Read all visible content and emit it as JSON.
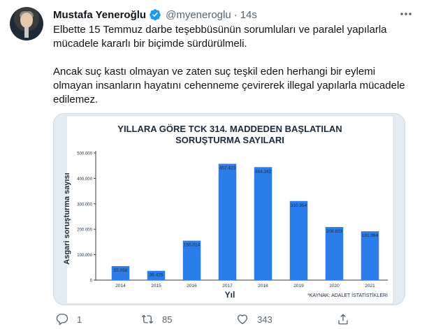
{
  "tweet": {
    "author_name": "Mustafa Yeneroğlu",
    "handle": "@myeneroglu",
    "separator": "·",
    "time": "14s",
    "paragraphs": [
      "Elbette 15 Temmuz darbe teşebbüsünün sorumluları ve paralel yapılarla mücadele kararlı bir biçimde sürdürülmeli.",
      "Ancak suç kastı olmayan ve zaten suç teşkil eden herhangi bir eylemi olmayan insanların hayatını cehenneme çevirerek illegal yapılarla mücadele edilemez."
    ],
    "stats": {
      "replies": "1",
      "retweets": "85",
      "likes": "343"
    },
    "icons": {
      "verified": "verified-badge-icon",
      "more": "more-icon",
      "reply": "reply-icon",
      "retweet": "retweet-icon",
      "like": "like-icon",
      "share": "share-icon"
    },
    "colors": {
      "verified": "#1d9bf0",
      "bar": "#2b7de9",
      "muted": "#536471"
    }
  },
  "chart_data": {
    "type": "bar",
    "title": "YILLARA GÖRE TCK 314. MADDEDEN BAŞLATILAN SORUŞTURMA SAYILARI",
    "title_lines": [
      "YILLARA GÖRE TCK 314. MADDEDEN BAŞLATILAN",
      "SORUŞTURMA SAYILARI"
    ],
    "xlabel": "Yıl",
    "ylabel": "Asgari soruşturma sayısı",
    "categories": [
      "2014",
      "2015",
      "2016",
      "2017",
      "2018",
      "2019",
      "2020",
      "2021"
    ],
    "values": [
      55058,
      36425,
      155014,
      457423,
      444342,
      310954,
      208833,
      191964
    ],
    "value_labels": [
      "55.058",
      "36.425",
      "155.014",
      "457.423",
      "444.342",
      "310.954",
      "208.833",
      "191.964"
    ],
    "y_ticks": [
      0,
      100000,
      200000,
      300000,
      400000,
      500000
    ],
    "y_tick_labels": [
      "0",
      "100.000",
      "200.000",
      "300.000",
      "400.000",
      "500.000"
    ],
    "ylim": [
      0,
      500000
    ],
    "grid": false,
    "source": "*KAYNAK: ADALET İSTATİSTİKLERİ"
  }
}
